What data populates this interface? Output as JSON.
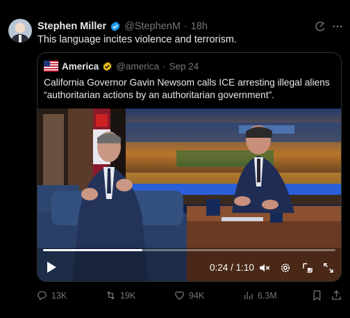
{
  "author": {
    "name": "Stephen Miller",
    "handle": "@StephenM",
    "separator": "·",
    "time": "18h"
  },
  "tweet_text": "This language incites violence and terrorism.",
  "quoted": {
    "name": "America",
    "handle": "@america",
    "separator": "·",
    "date": "Sep 24",
    "text": "California Governor Gavin Newsom calls ICE arresting illegal aliens “authoritarian actions by an authoritarian government”."
  },
  "video": {
    "elapsed": "0:24",
    "separator": "/",
    "duration": "1:10",
    "progress": 0.34
  },
  "actions": {
    "replies": "13K",
    "reposts": "19K",
    "likes": "94K",
    "views": "6.3M"
  },
  "icons": {
    "verified": "verified-badge-icon",
    "org_verified": "gold-check-icon",
    "grok": "grok-icon",
    "more": "more-icon",
    "play": "play-icon",
    "mute": "mute-icon",
    "settings": "gear-icon",
    "pip": "picture-in-picture-icon",
    "fullscreen": "fullscreen-icon",
    "reply": "reply-icon",
    "repost": "repost-icon",
    "like": "heart-icon",
    "views": "views-icon",
    "bookmark": "bookmark-icon",
    "share": "share-icon"
  },
  "colors": {
    "background": "#000000",
    "text": "#e7e9ea",
    "muted": "#71767b",
    "verified_blue": "#1d9bf0",
    "gold": "#e2b719",
    "border": "#2f3336"
  }
}
